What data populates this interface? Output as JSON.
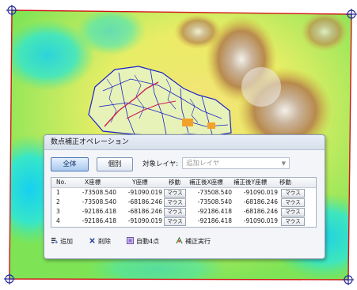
{
  "dialog": {
    "title": "数点補正オペレーション",
    "buttons": {
      "all": "全体",
      "individual": "個別"
    },
    "target_layer_label": "対象レイヤ:",
    "target_layer_value": "追加レイヤ",
    "columns": [
      "No.",
      "X座標",
      "Y座標",
      "移動",
      "補正後X座標",
      "補正後Y座標",
      "移動"
    ],
    "rows": [
      {
        "no": "1",
        "x": "-73508.540",
        "y": "-91090.019",
        "move": "マウス",
        "cx": "-73508.540",
        "cy": "-91090.019",
        "move2": "マウス"
      },
      {
        "no": "2",
        "x": "-73508.540",
        "y": "-68186.246",
        "move": "マウス",
        "cx": "-73508.540",
        "cy": "-68186.246",
        "move2": "マウス"
      },
      {
        "no": "3",
        "x": "-92186.418",
        "y": "-68186.246",
        "move": "マウス",
        "cx": "-92186.418",
        "cy": "-68186.246",
        "move2": "マウス"
      },
      {
        "no": "4",
        "x": "-92186.418",
        "y": "-91090.019",
        "move": "マウス",
        "cx": "-92186.418",
        "cy": "-91090.019",
        "move2": "マウス"
      }
    ],
    "footer": {
      "add": "追加",
      "delete": "削除",
      "auto4": "自動4点",
      "execute": "補正実行"
    }
  },
  "colors": {
    "frame_line": "#d11414",
    "crosshair": "#2b2b9c",
    "vector_lines": "#1a22c8",
    "highlight_lines": "#c81e5a"
  },
  "icons": {
    "crosshair": "crosshair-target-icon",
    "add": "add-row-icon",
    "delete": "delete-x-icon",
    "auto4": "auto-four-points-icon",
    "execute": "execute-correction-icon"
  }
}
